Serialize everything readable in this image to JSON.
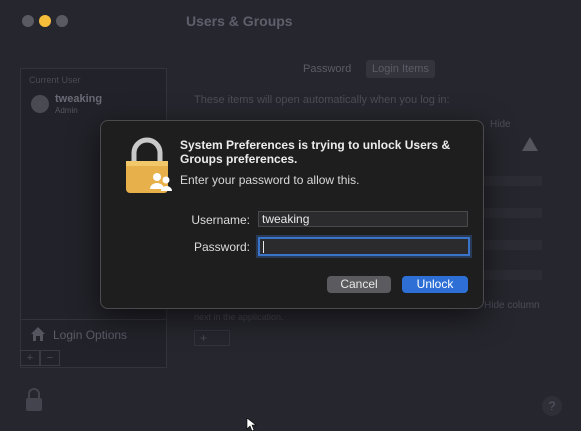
{
  "window": {
    "title": "Users & Groups"
  },
  "sidebar": {
    "header": "Current User",
    "user": {
      "name": "tweaking",
      "role": "Admin"
    },
    "login_options_label": "Login Options",
    "add_label": "+",
    "remove_label": "−"
  },
  "tabs": [
    {
      "label": "Password"
    },
    {
      "label": "Login Items"
    }
  ],
  "content": {
    "description": "These items will open automatically when you log in:",
    "hide_column": "Hide",
    "hide_column_note": "Hide column",
    "next_app_note": "next in the application.",
    "add_label": "+"
  },
  "dialog": {
    "title": "System Preferences is trying to unlock Users & Groups preferences.",
    "subtitle": "Enter your password to allow this.",
    "username_label": "Username:",
    "username_value": "tweaking",
    "password_label": "Password:",
    "password_value": "",
    "cancel_label": "Cancel",
    "unlock_label": "Unlock"
  },
  "help_label": "?",
  "colors": {
    "accent": "#2e6fd6",
    "focus_ring": "#3a74c8",
    "lock_gold": "#e8b04a",
    "minimize": "#f6bd3b"
  }
}
